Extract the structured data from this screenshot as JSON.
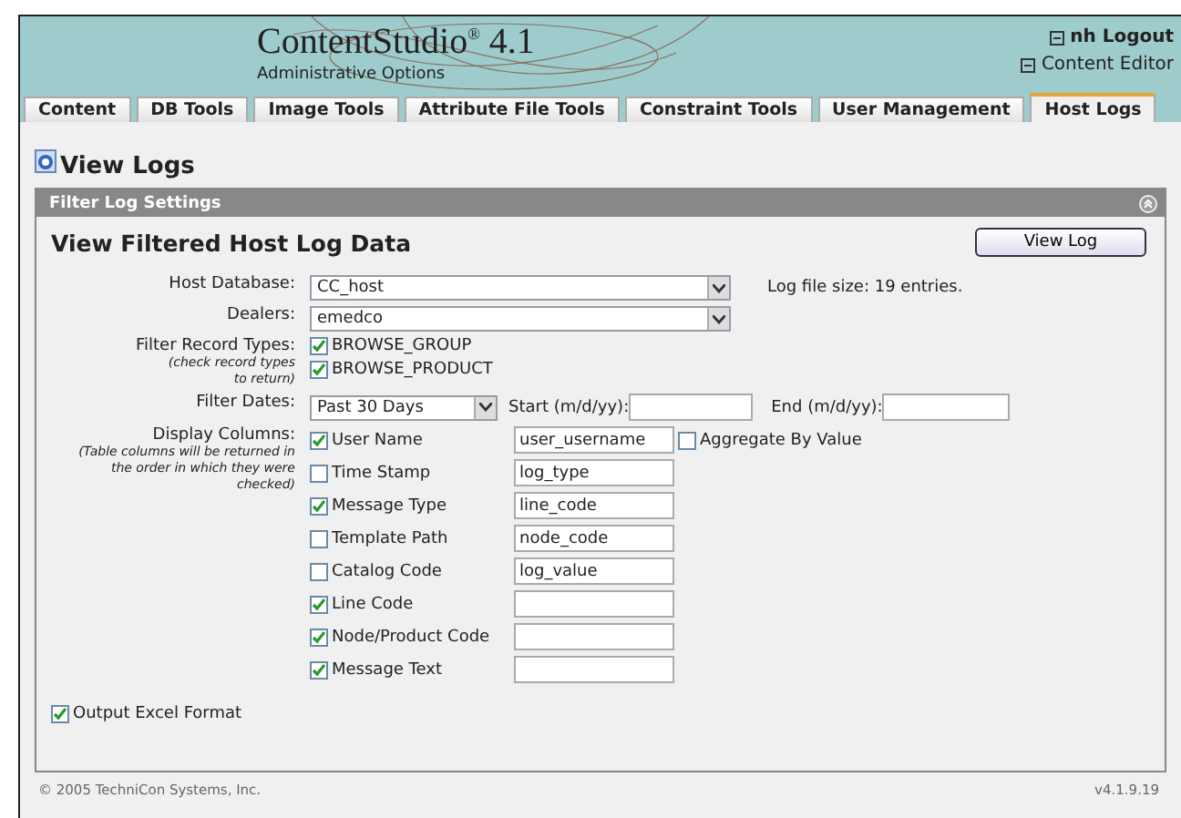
{
  "header": {
    "product": "ContentStudio",
    "reg": "®",
    "version": "4.1",
    "subtitle": "Administrative Options",
    "links": [
      "nh Logout",
      "Content Editor"
    ]
  },
  "tabs": [
    {
      "label": "Content",
      "selected": false
    },
    {
      "label": "DB Tools",
      "selected": false
    },
    {
      "label": "Image Tools",
      "selected": false
    },
    {
      "label": "Attribute File Tools",
      "selected": false
    },
    {
      "label": "Constraint Tools",
      "selected": false
    },
    {
      "label": "User Management",
      "selected": false
    },
    {
      "label": "Host Logs",
      "selected": true
    }
  ],
  "page_title": "View Logs",
  "panel": {
    "title": "Filter Log Settings",
    "heading": "View Filtered Host Log Data",
    "button": "View Log",
    "host_database": {
      "label": "Host Database:",
      "value": "CC_host"
    },
    "log_size": "Log file size: 19 entries.",
    "dealers": {
      "label": "Dealers:",
      "value": "emedco"
    },
    "record_types": {
      "label": "Filter Record Types:",
      "hint": "(check record types to return)",
      "items": [
        {
          "label": "BROWSE_GROUP",
          "checked": true
        },
        {
          "label": "BROWSE_PRODUCT",
          "checked": true
        }
      ]
    },
    "dates": {
      "label": "Filter Dates:",
      "value": "Past 30 Days",
      "start_label": "Start (m/d/yy):",
      "end_label": "End (m/d/yy):"
    },
    "columns": {
      "label": "Display Columns:",
      "hint": "(Table columns will be returned in the order in which they were checked)",
      "aggregate": {
        "label": "Aggregate By Value",
        "checked": false
      },
      "items": [
        {
          "label": "User Name",
          "checked": true,
          "field": "user_username"
        },
        {
          "label": "Time Stamp",
          "checked": false,
          "field": "log_type"
        },
        {
          "label": "Message Type",
          "checked": true,
          "field": "line_code"
        },
        {
          "label": "Template Path",
          "checked": false,
          "field": "node_code"
        },
        {
          "label": "Catalog Code",
          "checked": false,
          "field": "log_value"
        },
        {
          "label": "Line Code",
          "checked": true
        },
        {
          "label": "Node/Product Code",
          "checked": true
        },
        {
          "label": "Message Text",
          "checked": true
        }
      ]
    },
    "excel": {
      "label": "Output Excel Format",
      "checked": true
    }
  },
  "footer": {
    "copyright": "© 2005 TechniCon Systems, Inc.",
    "version": "v4.1.9.19"
  }
}
